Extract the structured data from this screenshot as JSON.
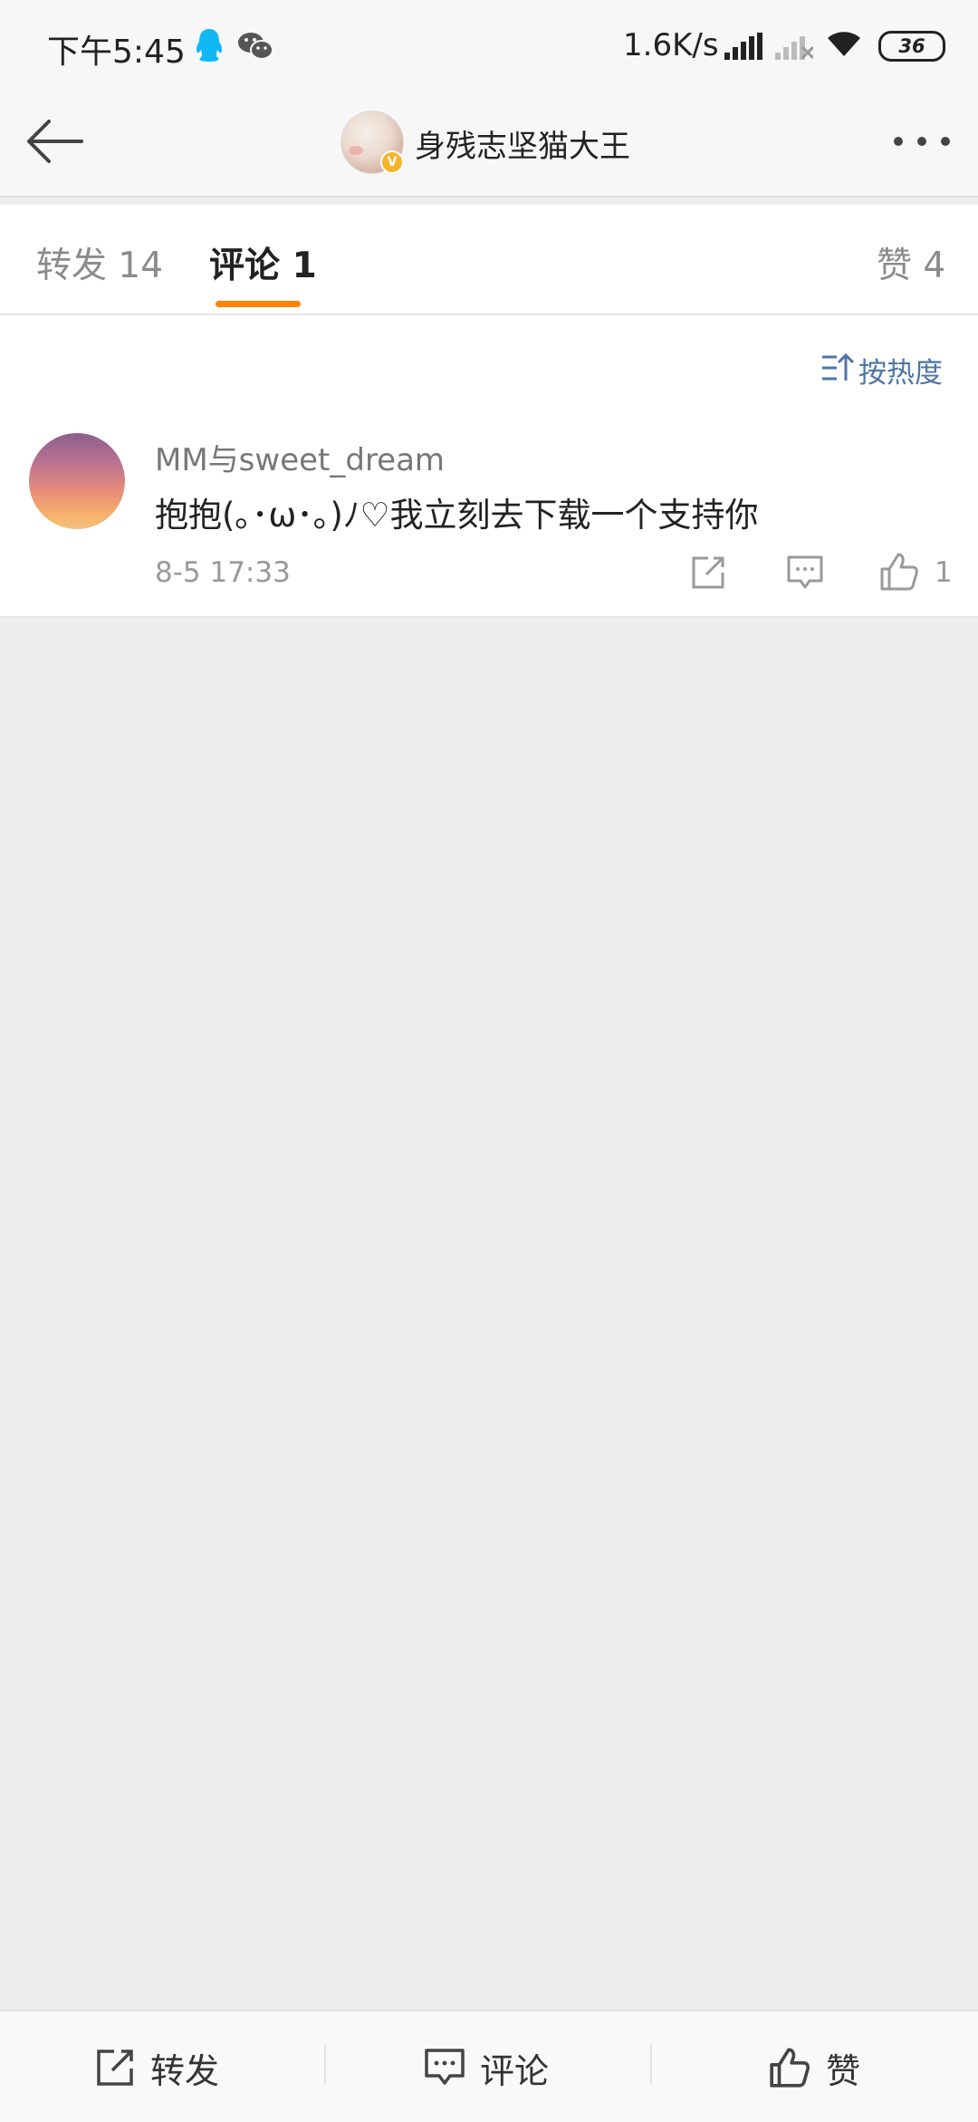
{
  "status_bar": {
    "time": "下午5:45",
    "net_speed": "1.6K/s",
    "battery": "36",
    "icons": [
      "qq-icon",
      "wechat-icon",
      "signal-icon",
      "signal-no-sim-icon",
      "wifi-icon",
      "battery-icon"
    ]
  },
  "title_bar": {
    "title": "身残志坚猫大王",
    "verified_mark": "V"
  },
  "tabs": [
    {
      "label": "转发 14"
    },
    {
      "label": "评论 1"
    },
    {
      "label": "赞 4"
    }
  ],
  "active_tab_color": "#ff8200",
  "sort": {
    "label": "按热度"
  },
  "comments": [
    {
      "user": "MM与sweet_dream",
      "text": "抱抱(｡･ω･｡)ﾉ♡我立刻去下载一个支持你",
      "time": "8-5 17:33",
      "likes": "1"
    }
  ],
  "bottom_bar": {
    "forward": "转发",
    "comment": "评论",
    "like": "赞"
  }
}
